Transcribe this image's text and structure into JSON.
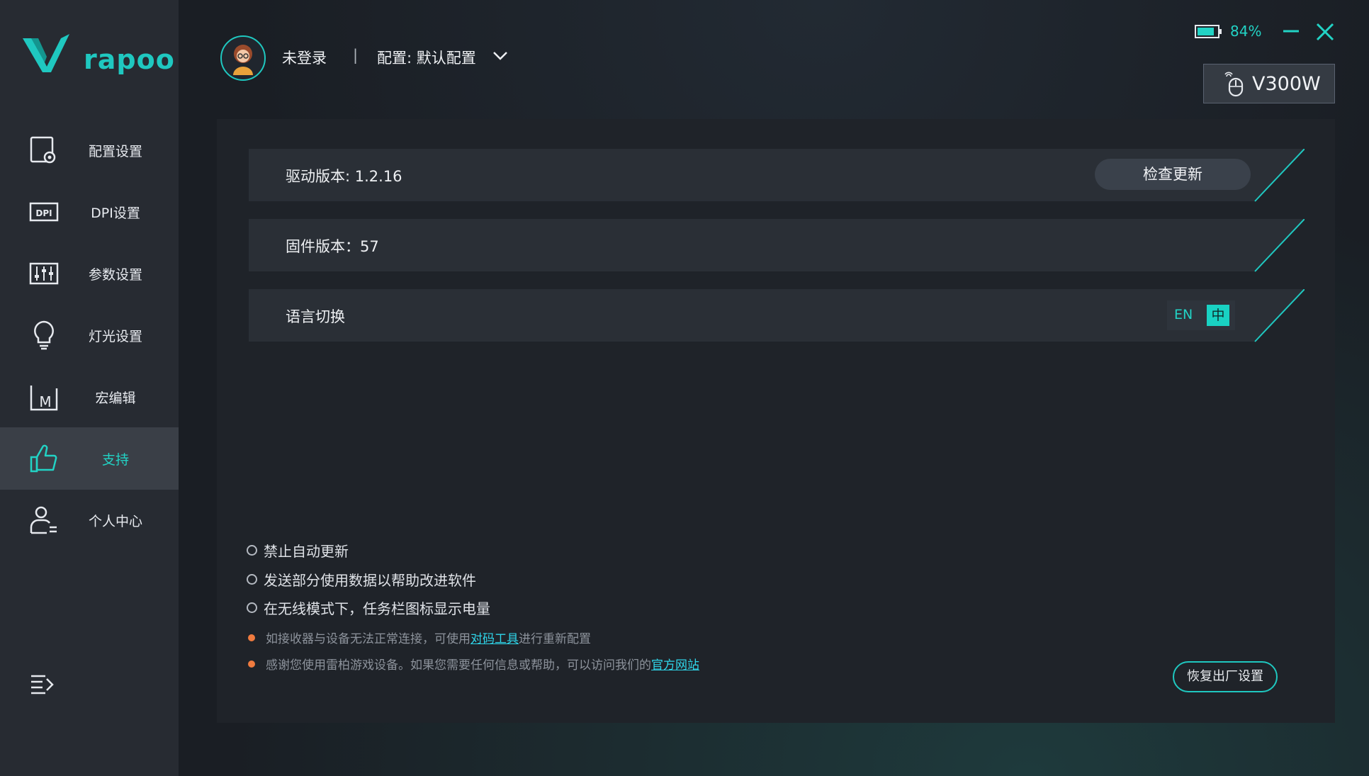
{
  "app": {
    "logo_text": "rapoo"
  },
  "header": {
    "user_status": "未登录",
    "separator": "|",
    "profile_label": "配置: 默认配置"
  },
  "status": {
    "battery_percent": "84%",
    "battery_level": 0.84
  },
  "device": {
    "name": "V300W"
  },
  "sidebar": {
    "items": [
      {
        "label": "配置设置",
        "icon": "profile-settings-icon",
        "active": false
      },
      {
        "label": "DPI设置",
        "icon": "dpi-icon",
        "active": false
      },
      {
        "label": "参数设置",
        "icon": "sliders-icon",
        "active": false
      },
      {
        "label": "灯光设置",
        "icon": "lightbulb-icon",
        "active": false
      },
      {
        "label": "宏编辑",
        "icon": "macro-icon",
        "active": false
      },
      {
        "label": "支持",
        "icon": "thumbs-up-icon",
        "active": true
      },
      {
        "label": "个人中心",
        "icon": "user-icon",
        "active": false
      }
    ]
  },
  "support": {
    "driver_version": "驱动版本: 1.2.16",
    "check_update_label": "检查更新",
    "firmware_version": "固件版本：57",
    "language_label": "语言切换",
    "lang_en": "EN",
    "lang_zh": "中",
    "options": [
      "禁止自动更新",
      "发送部分使用数据以帮助改进软件",
      "在无线模式下，任务栏图标显示电量"
    ],
    "note1_prefix": "如接收器与设备无法正常连接，可使用",
    "note1_link": "对码工具",
    "note1_suffix": "进行重新配置",
    "note2_prefix": "感谢您使用雷柏游戏设备。如果您需要任何信息或帮助，可以访问我们的",
    "note2_link": "官方网站",
    "restore_label": "恢复出厂设置"
  },
  "colors": {
    "accent": "#1fc8c0",
    "warning_dot": "#f07b3f",
    "link": "#2fd6ea"
  }
}
